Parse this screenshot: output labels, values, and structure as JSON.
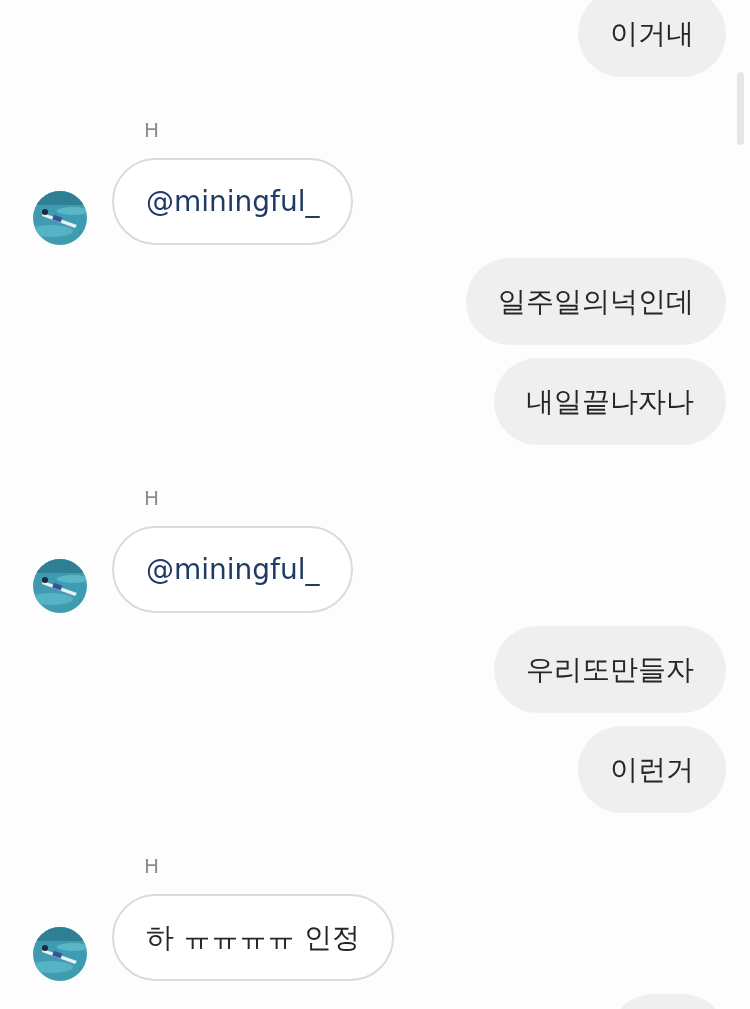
{
  "messages": [
    {
      "kind": "outgoing",
      "text": "이거내"
    },
    {
      "kind": "incoming",
      "sender": "H",
      "text": "@miningful_",
      "mention": true
    },
    {
      "kind": "outgoing",
      "text": "일주일의넉인데"
    },
    {
      "kind": "outgoing",
      "text": "내일끝나자나"
    },
    {
      "kind": "incoming",
      "sender": "H",
      "text": "@miningful_",
      "mention": true
    },
    {
      "kind": "outgoing",
      "text": "우리또만들자"
    },
    {
      "kind": "outgoing",
      "text": "이런거"
    },
    {
      "kind": "incoming",
      "sender": "H",
      "text": "하 ㅠㅠㅠㅠ 인정",
      "mention": false
    },
    {
      "kind": "outgoing-partial"
    }
  ]
}
